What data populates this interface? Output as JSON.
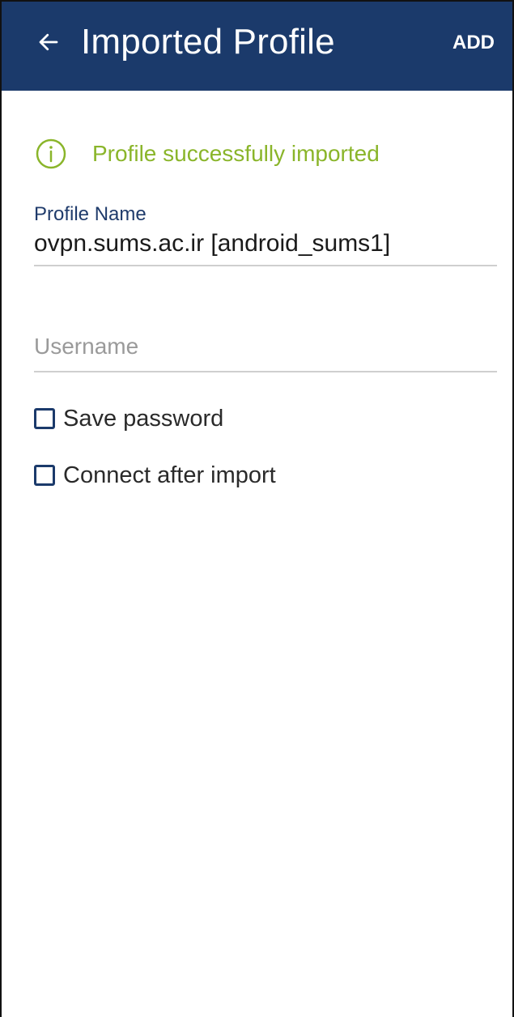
{
  "header": {
    "title": "Imported Profile",
    "back_icon": "arrow-left-icon",
    "add_label": "ADD",
    "background": "#1b3a6b"
  },
  "status": {
    "icon": "info-circle-icon",
    "message": "Profile successfully imported",
    "color": "#8ab52a"
  },
  "profile_name": {
    "label": "Profile Name",
    "value": "ovpn.sums.ac.ir [android_sums1]"
  },
  "username": {
    "placeholder": "Username",
    "value": ""
  },
  "options": {
    "save_password": {
      "label": "Save password",
      "checked": false
    },
    "connect_after_import": {
      "label": "Connect after import",
      "checked": false
    }
  }
}
